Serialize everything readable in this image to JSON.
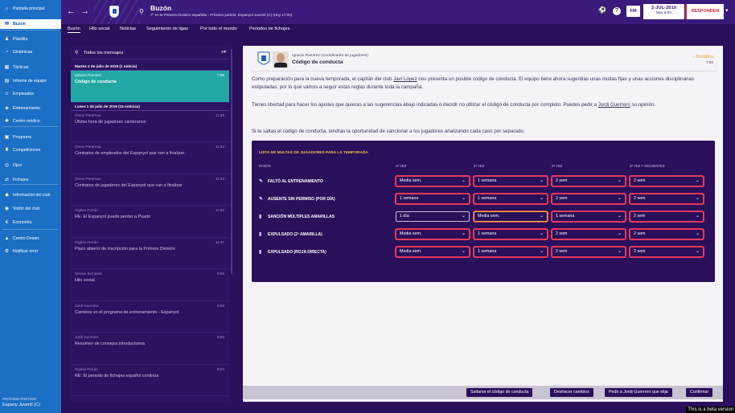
{
  "sidebar": {
    "items": [
      {
        "label": "Pantalla principal",
        "icon": "home-icon",
        "glyph": "⌂"
      },
      {
        "label": "Buzón",
        "icon": "inbox-icon",
        "glyph": "✉"
      },
      {
        "label": "Plantilla",
        "icon": "squad-icon",
        "glyph": "♟"
      },
      {
        "label": "Dinámicas",
        "icon": "dynamics-icon",
        "glyph": "◔"
      },
      {
        "label": "Tácticas",
        "icon": "tactics-icon",
        "glyph": "▦"
      },
      {
        "label": "Informe de equipo",
        "icon": "report-icon",
        "glyph": "▤"
      },
      {
        "label": "Empleados",
        "icon": "staff-icon",
        "glyph": "☺"
      },
      {
        "label": "Entrenamiento",
        "icon": "training-icon",
        "glyph": "◈"
      },
      {
        "label": "Centro médico",
        "icon": "medical-icon",
        "glyph": "✚"
      },
      {
        "label": "Programa",
        "icon": "schedule-icon",
        "glyph": "▣"
      },
      {
        "label": "Competiciones",
        "icon": "competitions-icon",
        "glyph": "♜"
      },
      {
        "label": "Ojeo",
        "icon": "scouting-icon",
        "glyph": "◎"
      },
      {
        "label": "Fichajes",
        "icon": "transfers-icon",
        "glyph": "⇄"
      },
      {
        "label": "Información del club",
        "icon": "club-info-icon",
        "glyph": "◆"
      },
      {
        "label": "Visión del club",
        "icon": "club-vision-icon",
        "glyph": "◉"
      },
      {
        "label": "Economía",
        "icon": "finances-icon",
        "glyph": "€"
      },
      {
        "label": "Centro Desarr.",
        "icon": "development-icon",
        "glyph": "▲"
      },
      {
        "label": "Notificar error",
        "icon": "bug-report-icon",
        "glyph": "⚙"
      }
    ],
    "next_match_label": "PRÓXIMO PARTIDO",
    "next_match_team": "Espany Juvenil (C)"
  },
  "topbar": {
    "title": "Buzón",
    "subtitle": "7º en la Primera División española - Próximo partido: Espanyol Juvenil (C)   (Hoy 17:00)",
    "fm_label": "FM",
    "date": "2-JUL-2019",
    "time": "Mar 8:00",
    "respond_label": "RESPONDER"
  },
  "tabs": [
    {
      "label": "Buzón"
    },
    {
      "label": "Hilo social"
    },
    {
      "label": "Noticias"
    },
    {
      "label": "Seguimiento de ligas"
    },
    {
      "label": "Por todo el mundo"
    },
    {
      "label": "Periodos de fichajes"
    }
  ],
  "messages": {
    "header": "Todos los mensajes",
    "group1": "Martes 2 de julio de 2019 (1 noticia)",
    "group2": "Lunes 1 de julio de 2019 (15 noticias)",
    "selected": {
      "sender": "Ignacio Ramírez",
      "subject": "Código de conducta",
      "time": "7:59"
    },
    "items": [
      {
        "sender": "Óscar Perarnau",
        "subject": "Última hora de jugadores canteranos",
        "time": "11:59"
      },
      {
        "sender": "Óscar Perarnau",
        "subject": "Contratos de empleados del Espanyol que van a finalizar",
        "time": "11:53"
      },
      {
        "sender": "Óscar Perarnau",
        "subject": "Contratos de jugadores del Espanyol que van a finalizar",
        "time": "11:53"
      },
      {
        "sender": "Higinio Ferrón",
        "subject": "RE: El Espanyol puede perder a Puado",
        "time": "11:50"
      },
      {
        "sender": "Higinio Ferrón",
        "subject": "Plazo abierto de inscripción para la Primera División",
        "time": "11:47"
      },
      {
        "sender": "Nieves Sempere",
        "subject": "Hilo social",
        "time": "9:06"
      },
      {
        "sender": "Jordi Guerrero",
        "subject": "Cambios en el programa de entrenamiento - Espanyol",
        "time": "9:00"
      },
      {
        "sender": "Jordi Guerrero",
        "subject": "Resumen de consejos introductorios",
        "time": "9:00"
      },
      {
        "sender": "Higinio Ferrón",
        "subject": "RE: El periodo de fichajes español continúa",
        "time": "8:34"
      }
    ]
  },
  "message": {
    "from": "Ignacio Ramírez  (Coordinador de jugadores)",
    "title": "Código de conducta",
    "tag": "Disciplina",
    "time": "7:59",
    "p1_a": "Como preparación para la nueva temporada, el capitán del club ",
    "p1_link": "Javi López",
    "p1_b": " nos presenta un posible código de conducta. El equipo tiene ahora sugeridas unas multas fijas y unas acciones disciplinarias estipuladas, por lo que vamos a seguir estas reglas durante toda la campaña.",
    "p2_a": "Tienes libertad para hacer los ajustes que quieras a las sugerencias abajo indicadas o decidir no utilizar el código de conducta por completo. Puedes pedir a ",
    "p2_link": "Jordi Guerrero",
    "p2_b": " su opinión.",
    "p3": "Si te saltas el código de conducta, tendrás la oportunidad de sancionar a los jugadores analizando cada caso por separado."
  },
  "fines": {
    "title": "Lista de multas de jugadores para la temporada",
    "headers": [
      "Razón",
      "1ª vez",
      "2ª vez",
      "3ª vez",
      "4ª vez y siguientes"
    ],
    "rows": [
      {
        "label": "FALTÓ AL ENTRENAMIENTO",
        "icon": "missed-training-icon",
        "glyph": "✎",
        "values": [
          "Media sem.",
          "1 semana",
          "2 sem",
          "2 sem"
        ]
      },
      {
        "label": "AUSENTE SIN PERMISO (POR DÍA)",
        "icon": "absent-icon",
        "glyph": "✎",
        "values": [
          "1 semana",
          "1 semana",
          "2 sem",
          "2 sem"
        ]
      },
      {
        "label": "SANCIÓN MÚLTIPLES AMARILLAS",
        "icon": "yellow-cards-icon",
        "glyph": "▮",
        "values": [
          "1 día",
          "Media sem.",
          "1 semana",
          "2 sem"
        ]
      },
      {
        "label": "EXPULSADO (2ª AMARILLA)",
        "icon": "second-yellow-icon",
        "glyph": "▮",
        "values": [
          "Media sem.",
          "1 semana",
          "2 sem",
          "2 sem"
        ]
      },
      {
        "label": "EXPULSADO (ROJA DIRECTA)",
        "icon": "red-card-icon",
        "glyph": "▮",
        "values": [
          "Media sem.",
          "1 semana",
          "2 sem",
          "2 sem"
        ]
      }
    ]
  },
  "footer": {
    "skip": "Saltarse el código de conducta",
    "undo": "Deshacer cambios",
    "ask": "Pedir a Jordi Guerrero que elija",
    "confirm": "Confirmar"
  },
  "beta": "This is a beta version",
  "colors": {
    "sidebar": "#1b6fc4",
    "purple": "#2a0f5a",
    "teal": "#23a8a6",
    "accent_red": "#d0203a"
  }
}
